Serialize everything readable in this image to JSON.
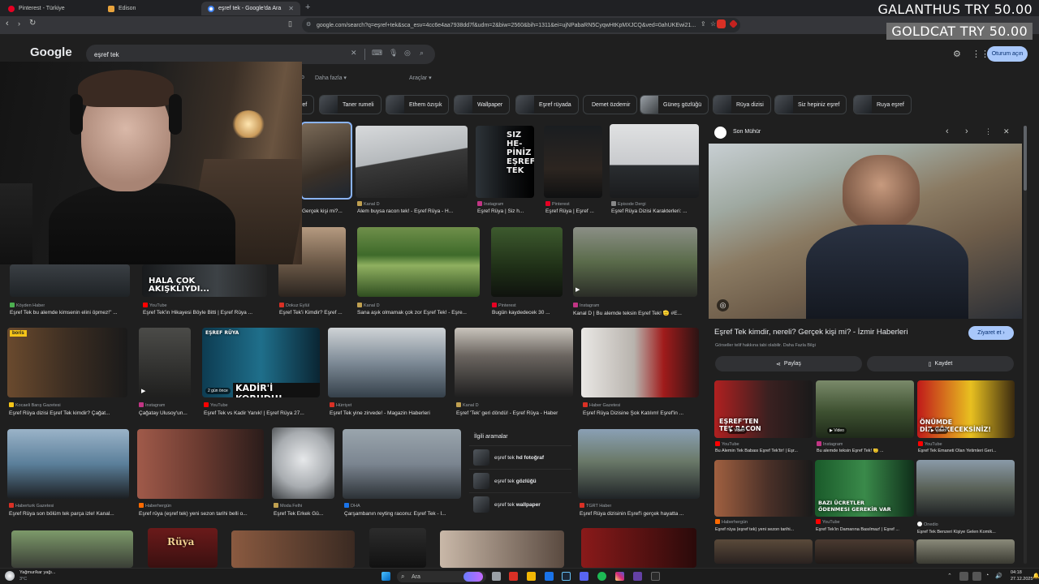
{
  "browser": {
    "tabs": [
      {
        "label": "Pinterest - Türkiye",
        "active": false
      },
      {
        "label": "Edison",
        "active": false
      },
      {
        "label": "eşref tek - Google'da Ara",
        "active": true
      }
    ],
    "url": "google.com/search?q=eşref+tek&sca_esv=4cc6e4aa7938dd7f&udm=2&biw=2560&bih=1311&ei=ujNPabaRN5CyqwHtKpMXJCQ&ved=0ahUKEwi21..."
  },
  "overlay": {
    "price1": "GALANTHUS  TRY 50.00",
    "price2": "GOLDCAT  TRY 50.00"
  },
  "google": {
    "logo": "Google",
    "query": "eşref tek",
    "signin": "Oturum açın",
    "more": "Daha fazla",
    "tools": "Araçlar",
    "b_frag": "b"
  },
  "chips": [
    {
      "label": "ref"
    },
    {
      "label": "Taner rumeli"
    },
    {
      "label": "Ethem özışık"
    },
    {
      "label": "Wallpaper"
    },
    {
      "label": "Eşref rüyada"
    },
    {
      "label": "Demet özdemir"
    },
    {
      "label": "Güneş gözlüğü"
    },
    {
      "label": "Rüya dizisi"
    },
    {
      "label": "Siz hepiniz eşref"
    },
    {
      "label": "Ruya eşref"
    }
  ],
  "row1": [
    {
      "src": "",
      "cap": "Gerçek kişi mi?..."
    },
    {
      "src": "Kanal D",
      "cap": "Alem buysa racon tek! - Eşref Rüya - H..."
    },
    {
      "src": "Instagram",
      "cap": "Eşref Rüya | Siz h..."
    },
    {
      "src": "Pinterest",
      "cap": "Eşref Rüya | Eşref ..."
    },
    {
      "src": "Episode Dergi",
      "cap": "Eşref Rüya Dizisi Karakterleri: ..."
    }
  ],
  "row1_overlay": [
    "SIZ",
    "HE-",
    "PİNİZ",
    "EŞREF",
    "TEK"
  ],
  "row2": [
    {
      "src": "Köyden Haber",
      "cap": "Eşref Tek bu alemde kimsenin elini öpmez!\" ..."
    },
    {
      "src": "YouTube",
      "cap": "Eşref Tek'in Hikayesi Böyle Bitti | Eşref Rüya ..."
    },
    {
      "src": "Dokuz Eylül",
      "cap": "Eşref Tek'i Kimdir? Eşref ..."
    },
    {
      "src": "Kanal D",
      "cap": "Sana aşık olmamak çok zor Eşref Tek! - Eşre..."
    },
    {
      "src": "Pinterest",
      "cap": "Bugün kaydedecek 30 ..."
    },
    {
      "src": "Instagram",
      "cap": "Kanal D | Bu alemde teksin Eşref Tek! 🫡 #E..."
    }
  ],
  "row2_overlay": "HALA ÇOK\nAKIŞKLIYDI...",
  "row3": [
    {
      "src": "Kocaeli Barış Gazetesi",
      "cap": "Eşref Rüya dizisi Eşref Tek kimdir? Çağat..."
    },
    {
      "src": "Instagram",
      "cap": "Çağatay Ulusoy'un..."
    },
    {
      "src": "YouTube",
      "cap": "Eşref Tek vs Kadir Yanık! | Eşref Rüya 27..."
    },
    {
      "src": "Hürriyet",
      "cap": "Eşref Tek yine zirvede! - Magazin Haberleri"
    },
    {
      "src": "Kanal D",
      "cap": "Eşref 'Tek' geri döndü! - Eşref Rüya - Haber"
    },
    {
      "src": "Haber Gazetesi",
      "cap": "Eşref Rüya Dizisine Şok Katılım! Eşref'in ..."
    }
  ],
  "row3_overlays": {
    "boris": "boris",
    "yt_title": "EŞREF RÜYA",
    "kadir": "KADİR'İ KORUDU!",
    "duration": "2 gün önce"
  },
  "row4": [
    {
      "src": "Haberturk Gazetesi",
      "cap": "Eşref Rüya son bölüm tek parça izle! Kanal..."
    },
    {
      "src": "Haberhergün",
      "cap": "Eşref rüya (eşref tek) yeni sezon tarihi belli o..."
    },
    {
      "src": "Moda Felhi",
      "cap": "Eşref Tek Erkek Gü..."
    },
    {
      "src": "DHA",
      "cap": "Çarşambanın reyting raconu: Eşref Tek - İ..."
    },
    {
      "src": "TGRT Haber",
      "cap": "Eşref Rüya dizisinin Eşref'i gerçek hayatta ..."
    }
  ],
  "related": {
    "title": "İlgili aramalar",
    "items": [
      {
        "pre": "eşref tek ",
        "bold": "hd fotoğraf"
      },
      {
        "pre": "eşref tek ",
        "bold": "gözlüğü"
      },
      {
        "pre": "eşref tek ",
        "bold": "wallpaper"
      }
    ]
  },
  "row5_overlay": "Rüya",
  "panel": {
    "source": "Son Mühür",
    "title": "Eşref Tek kimdir, nereli? Gerçek kişi mi? - İzmir Haberleri",
    "visit": "Ziyaret et",
    "note": "Görseller telif hakkına tabi olabilir. Daha Fazla Bilgi",
    "share": "Paylaş",
    "save": "Kaydet",
    "video_tag": "Video",
    "grid1": [
      {
        "src": "YouTube",
        "cap": "Bu Alemin Tek Babası Eşref Tek'tir! | Eşr...",
        "overlay": "EŞREF'TEN\nTEK RACON"
      },
      {
        "src": "Instagram",
        "cap": "Bu alemde teksin Eşref Tek! 🫡 ..."
      },
      {
        "src": "YouTube",
        "cap": "Eşref Tek Emaneti Olan Yetimleri Geri...",
        "overlay": "ÖNÜMDE\nDİZ ÇÖKECEKSİNİZ!"
      }
    ],
    "grid2": [
      {
        "src": "Haberhergün",
        "cap": "Eşref rüya (eşref tek) yeni sezon tarihi..."
      },
      {
        "src": "YouTube",
        "cap": "Eşref Tek'in Damarına Basılmaz! | Eşref ...",
        "overlay": "BAZI ÜCRETLER\nÖDENMESI GEREKİR VAR"
      },
      {
        "src": "Onedio",
        "cap": "Eşref Tek Benzeri Kişiye Gelen Komik..."
      }
    ]
  },
  "taskbar": {
    "weather": "Yağmur/kar yağı...",
    "temp": "3°C",
    "search": "Ara",
    "time": "04:18",
    "date": "27.12.2025"
  }
}
